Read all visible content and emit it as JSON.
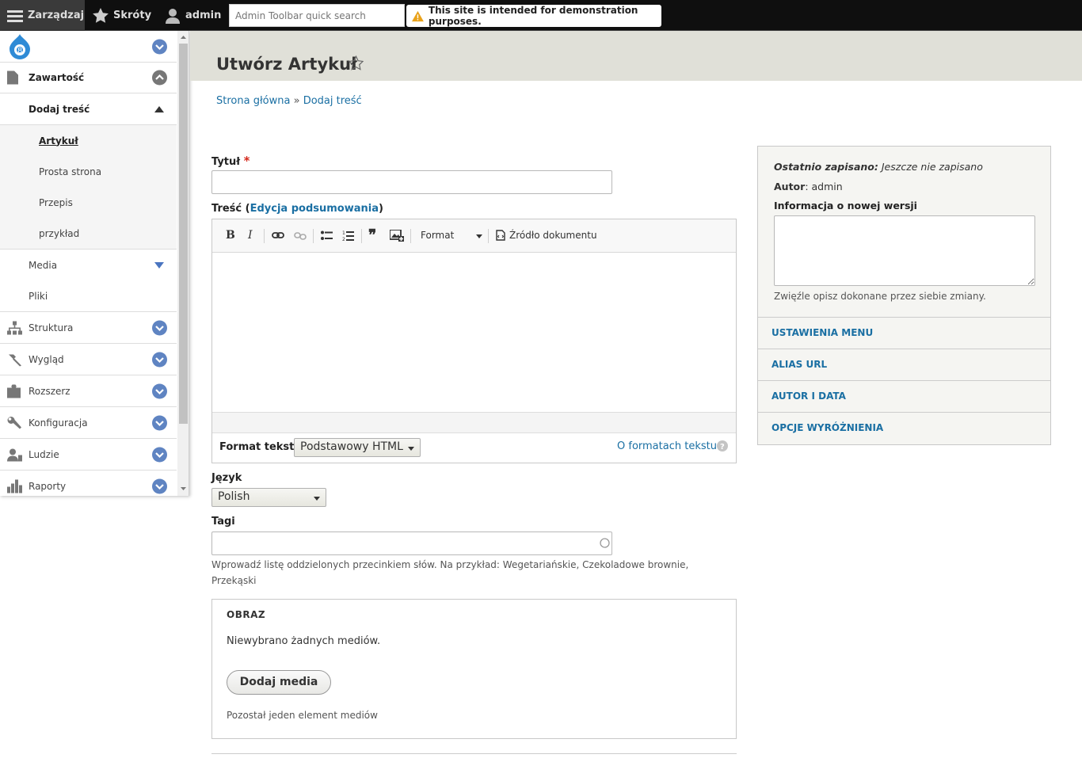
{
  "toolbar": {
    "manage": "Zarządzaj",
    "shortcuts": "Skróty",
    "user": "admin",
    "search_placeholder": "Admin Toolbar quick search",
    "notice": "This site is intended for demonstration purposes."
  },
  "sidebar": {
    "items": [
      {
        "label": "Zawartość",
        "icon": "file-icon"
      },
      {
        "label": "Dodaj treść"
      },
      {
        "label": "Artykuł"
      },
      {
        "label": "Prosta strona"
      },
      {
        "label": "Przepis"
      },
      {
        "label": "przykład"
      },
      {
        "label": "Media"
      },
      {
        "label": "Pliki"
      },
      {
        "label": "Struktura",
        "icon": "sitemap-icon"
      },
      {
        "label": "Wygląd",
        "icon": "paint-icon"
      },
      {
        "label": "Rozszerz",
        "icon": "puzzle-icon"
      },
      {
        "label": "Konfiguracja",
        "icon": "wrench-icon"
      },
      {
        "label": "Ludzie",
        "icon": "people-icon"
      },
      {
        "label": "Raporty",
        "icon": "chart-icon"
      }
    ]
  },
  "page": {
    "title": "Utwórz Artykuł",
    "breadcrumb_home": "Strona główna",
    "breadcrumb_sep": "»",
    "breadcrumb_current": "Dodaj treść"
  },
  "form": {
    "title_label": "Tytuł",
    "required_mark": "*",
    "body_label": "Treść",
    "summary_link": "Edycja podsumowania",
    "format_dropdown": "Format",
    "source_button": "Źródło dokumentu",
    "text_format_label": "Format tekstu",
    "text_format_value": "Podstawowy HTML",
    "about_formats": "O formatach tekstu",
    "language_label": "Język",
    "language_value": "Polish",
    "tags_label": "Tagi",
    "tags_desc": "Wprowadź listę oddzielonych przecinkiem słów. Na przykład: Wegetariańskie, Czekoladowe brownie, Przekąski",
    "image_legend": "OBRAZ",
    "no_media": "Niewybrano żadnych mediów.",
    "add_media": "Dodaj media",
    "remaining": "Pozostał jeden element mediów"
  },
  "meta": {
    "last_saved_label": "Ostatnio zapisano:",
    "last_saved_value": "Jeszcze nie zapisano",
    "author_label": "Autor",
    "author_value": "admin",
    "revision_label": "Informacja o nowej wersji",
    "revision_desc": "Zwięźle opisz dokonane przez siebie zmiany.",
    "sections": [
      "USTAWIENIA MENU",
      "ALIAS URL",
      "AUTOR I DATA",
      "OPCJE WYRÓŻNIENIA"
    ]
  },
  "colors": {
    "toolbar_bg": "#0f0f0f",
    "link": "#1a6fa3",
    "toggle_blue": "#5f84c2",
    "required": "#d4291c"
  }
}
